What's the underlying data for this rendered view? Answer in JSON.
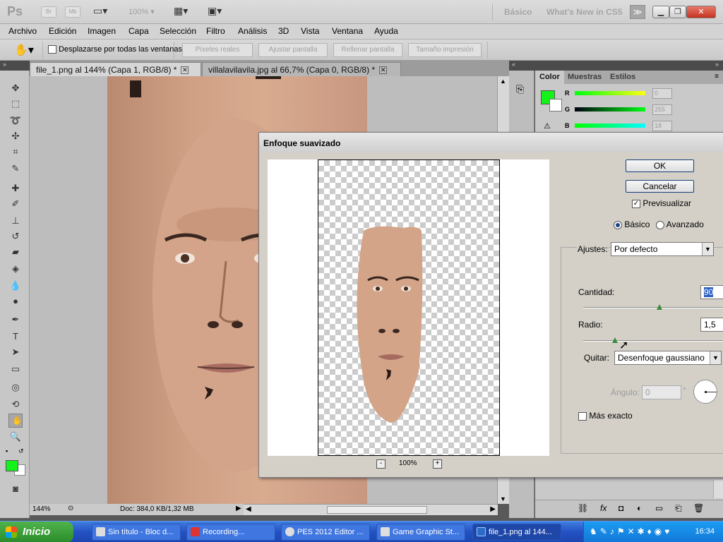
{
  "appbar": {
    "logo": "Ps",
    "br": "Br",
    "mb": "Mb",
    "zoom": "100%",
    "workspace_basic": "Básico",
    "whats_new": "What's New in CS5",
    "expand": "≫"
  },
  "menu": [
    "Archivo",
    "Edición",
    "Imagen",
    "Capa",
    "Selección",
    "Filtro",
    "Análisis",
    "3D",
    "Vista",
    "Ventana",
    "Ayuda"
  ],
  "options": {
    "scroll_all": "Desplazarse por todas las ventanas",
    "buttons": [
      "Píxeles reales",
      "Ajustar pantalla",
      "Rellenar pantalla",
      "Tamaño impresión"
    ]
  },
  "tabs": [
    {
      "label": "file_1.png al 144% (Capa 1, RGB/8) *",
      "active": true
    },
    {
      "label": "villalavilavila.jpg al 66,7% (Capa 0, RGB/8) *",
      "active": false
    }
  ],
  "status": {
    "zoom": "144%",
    "doc": "Doc: 384,0 KB/1,32 MB"
  },
  "panel": {
    "tabs": [
      "Color",
      "Muestras",
      "Estilos"
    ],
    "r_label": "R",
    "r_value": "0",
    "g_label": "G",
    "g_value": "255",
    "b_label": "B",
    "b_value": "18",
    "foreground_color": "#14f21a"
  },
  "dialog": {
    "title": "Enfoque suavizado",
    "zoom": "100%",
    "zoom_minus": "-",
    "zoom_plus": "+",
    "ok": "OK",
    "cancel": "Cancelar",
    "preview": "Previsualizar",
    "basic": "Básico",
    "advanced": "Avanzado",
    "settings_label": "Ajustes:",
    "settings_value": "Por defecto",
    "amount_label": "Cantidad:",
    "amount_value": "90",
    "radius_label": "Radio:",
    "radius_value": "1,5",
    "remove_label": "Quitar:",
    "remove_value": "Desenfoque gaussiano",
    "angle_label": "Ángulo:",
    "angle_value": "0",
    "angle_unit": "°",
    "more_accurate": "Más exacto"
  },
  "taskbar": {
    "start": "Inicio",
    "items": [
      {
        "label": "Sin título - Bloc d...",
        "active": false
      },
      {
        "label": "Recording...",
        "active": false
      },
      {
        "label": "PES 2012 Editor ...",
        "active": false
      },
      {
        "label": "Game Graphic St...",
        "active": false
      },
      {
        "label": "file_1.png al 144...",
        "active": true
      }
    ],
    "clock": "16:34"
  }
}
